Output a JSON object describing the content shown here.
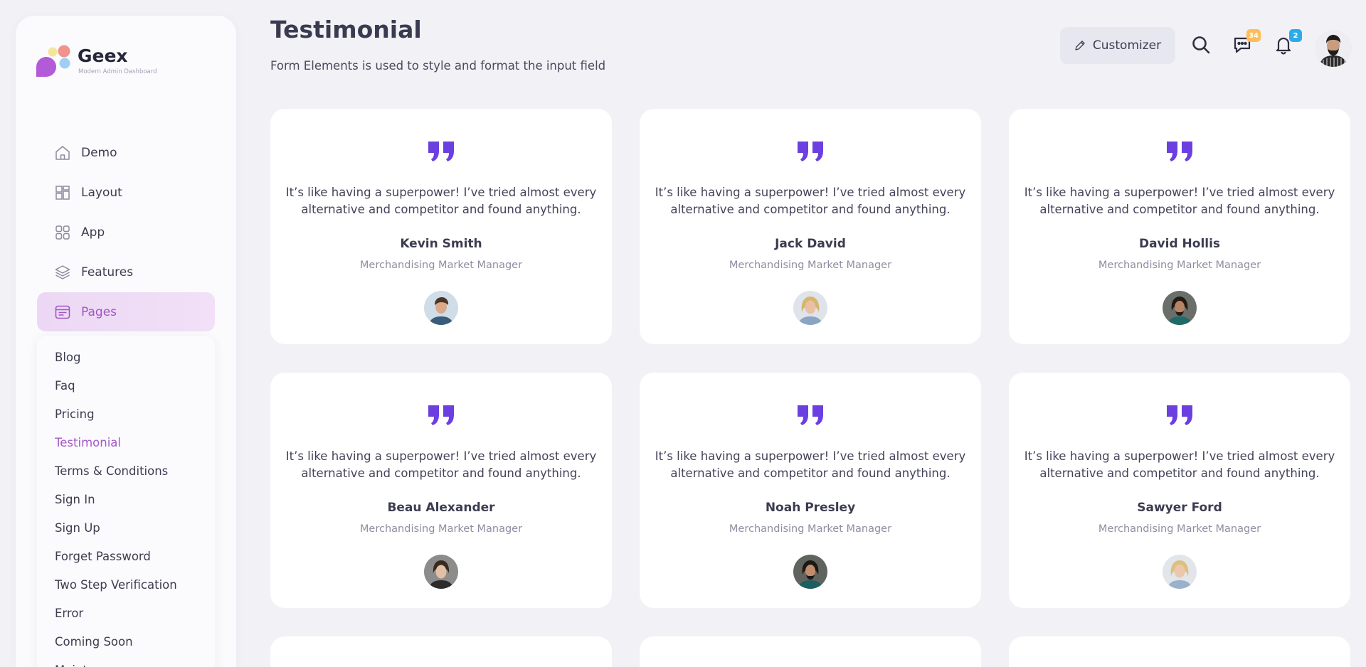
{
  "brand": {
    "title": "Geex",
    "subtitle": "Modern Admin Dashboard"
  },
  "nav": {
    "items": [
      {
        "label": "Demo",
        "icon": "home-icon"
      },
      {
        "label": "Layout",
        "icon": "layout-icon"
      },
      {
        "label": "App",
        "icon": "apps-grid-icon"
      },
      {
        "label": "Features",
        "icon": "layers-icon"
      },
      {
        "label": "Pages",
        "icon": "pages-icon",
        "active": true
      }
    ],
    "submenu": [
      "Blog",
      "Faq",
      "Pricing",
      "Testimonial",
      "Terms & Conditions",
      "Sign In",
      "Sign Up",
      "Forget Password",
      "Two Step Verification",
      "Error",
      "Coming Soon",
      "Maintenance"
    ],
    "submenu_active": "Testimonial"
  },
  "header": {
    "title": "Testimonial",
    "subtitle": "Form Elements is used to style and format the input field",
    "customizer_label": "Customizer",
    "messages_badge": "34",
    "notifications_badge": "2"
  },
  "testimonials": [
    {
      "quote": "It’s like having a superpower! I’ve tried almost every alternative and competitor and found anything.",
      "name": "Kevin Smith",
      "role": "Merchandising Market Manager"
    },
    {
      "quote": "It’s like having a superpower! I’ve tried almost every alternative and competitor and found anything.",
      "name": "Jack David",
      "role": "Merchandising Market Manager"
    },
    {
      "quote": "It’s like having a superpower! I’ve tried almost every alternative and competitor and found anything.",
      "name": "David Hollis",
      "role": "Merchandising Market Manager"
    },
    {
      "quote": "It’s like having a superpower! I’ve tried almost every alternative and competitor and found anything.",
      "name": "Beau Alexander",
      "role": "Merchandising Market Manager"
    },
    {
      "quote": "It’s like having a superpower! I’ve tried almost every alternative and competitor and found anything.",
      "name": "Noah Presley",
      "role": "Merchandising Market Manager"
    },
    {
      "quote": "It’s like having a superpower! I’ve tried almost every alternative and competitor and found anything.",
      "name": "Sawyer Ford",
      "role": "Merchandising Market Manager"
    }
  ],
  "colors": {
    "accent": "#6b3fe0",
    "active_nav_text": "#a156c6",
    "active_nav_bg": "#ecd8f4",
    "page_bg": "#f1f1f6",
    "badge_orange": "#ffbd5a",
    "badge_blue": "#2dabe8"
  }
}
